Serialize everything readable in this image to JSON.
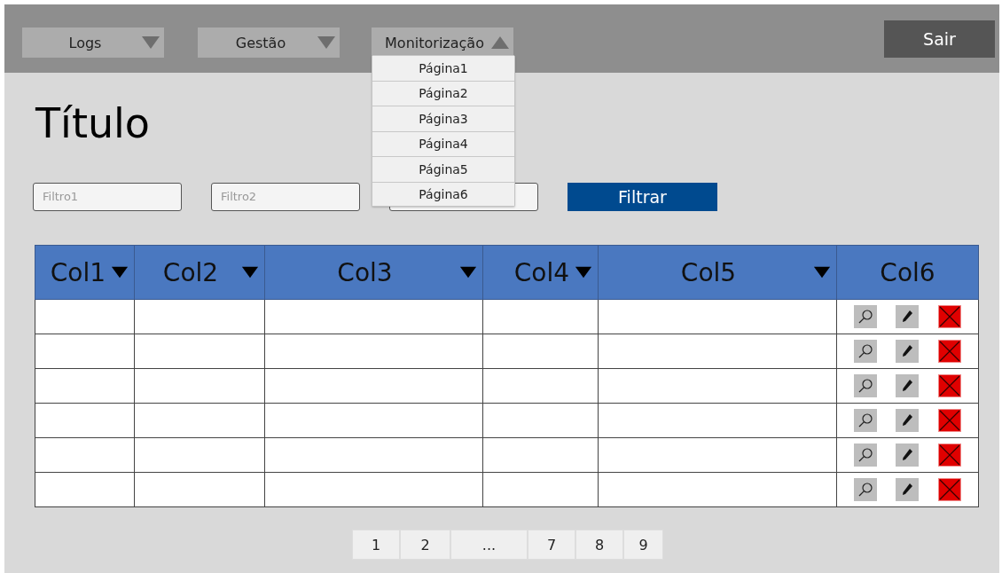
{
  "nav": {
    "menus": [
      {
        "label": "Logs",
        "expanded": false
      },
      {
        "label": "Gestão",
        "expanded": false
      },
      {
        "label": "Monitorização",
        "expanded": true,
        "items": [
          {
            "label": "Página1"
          },
          {
            "label": "Página2"
          },
          {
            "label": "Página3"
          },
          {
            "label": "Página4"
          },
          {
            "label": "Página5"
          },
          {
            "label": "Página6"
          }
        ]
      }
    ],
    "exit_button": "Sair"
  },
  "title": "Título",
  "filters": [
    {
      "kind": "text",
      "placeholder": "Filtro1"
    },
    {
      "kind": "text",
      "placeholder": "Filtro2"
    },
    {
      "kind": "text"
    }
  ],
  "filter_button": "Filtrar",
  "table": {
    "columns": [
      {
        "label": "Col1",
        "sortable": true
      },
      {
        "label": "Col2",
        "sortable": true
      },
      {
        "label": "Col3",
        "sortable": true
      },
      {
        "label": "Col4",
        "sortable": true
      },
      {
        "label": "Col5",
        "sortable": true
      },
      {
        "label": "Col6",
        "sortable": false
      }
    ],
    "rows": [
      {
        "actions": [
          {
            "kind": "view"
          },
          {
            "kind": "edit"
          },
          {
            "kind": "delete"
          }
        ]
      },
      {
        "actions": [
          {
            "kind": "view"
          },
          {
            "kind": "edit"
          },
          {
            "kind": "delete"
          }
        ]
      },
      {
        "actions": [
          {
            "kind": "view"
          },
          {
            "kind": "edit"
          },
          {
            "kind": "delete"
          }
        ]
      },
      {
        "actions": [
          {
            "kind": "view"
          },
          {
            "kind": "edit"
          },
          {
            "kind": "delete"
          }
        ]
      },
      {
        "actions": [
          {
            "kind": "view"
          },
          {
            "kind": "edit"
          },
          {
            "kind": "delete"
          }
        ]
      },
      {
        "actions": [
          {
            "kind": "view"
          },
          {
            "kind": "edit"
          },
          {
            "kind": "delete"
          }
        ]
      }
    ]
  },
  "pagination": [
    "1",
    "2",
    "...",
    "7",
    "8",
    "9"
  ]
}
